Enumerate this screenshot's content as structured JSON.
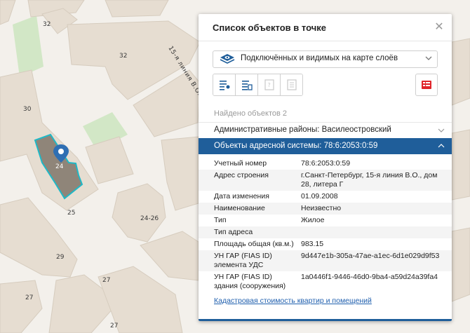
{
  "map": {
    "house_numbers": [
      "32",
      "32",
      "30",
      "24",
      "24-26",
      "29",
      "27",
      "27",
      "27",
      "25"
    ],
    "street_name": "15-я линия В.О.",
    "marker_icon": "map-pin-icon"
  },
  "panel": {
    "title": "Список объектов в точке",
    "close_icon": "close-icon",
    "layer_selector": {
      "value": "Подключённых и видимых на карте слоёв",
      "icon": "layers-eye-icon"
    },
    "toolbar_icons": [
      "list-pin-icon",
      "list-select-icon",
      "help-doc-icon",
      "document-icon"
    ],
    "right_tool_icon": "report-icon",
    "found_label": "Найдено объектов 2",
    "sections": [
      {
        "label": "Административные районы: Василеостровский",
        "expanded": false
      },
      {
        "label": "Объекты адресной системы: 78:6:2053:0:59",
        "expanded": true
      }
    ],
    "properties": [
      {
        "key": "Учетный номер",
        "value": "78:6:2053:0:59"
      },
      {
        "key": "Адрес строения",
        "value": "г.Санкт-Петербург, 15-я линия В.О., дом 28, литера Г"
      },
      {
        "key": "Дата изменения",
        "value": "01.09.2008"
      },
      {
        "key": "Наименование",
        "value": "Неизвестно"
      },
      {
        "key": "Тип",
        "value": "Жилое"
      },
      {
        "key": "Тип адреса",
        "value": ""
      },
      {
        "key": "Площадь общая (кв.м.)",
        "value": "983.15"
      },
      {
        "key": "УН ГАР (FIAS ID) элемента УДС",
        "value": "9d447e1b-305a-47ae-a1ec-6d1e029d9f53"
      },
      {
        "key": "УН ГАР (FIAS ID) здания (сооружения)",
        "value": "1a0446f1-9446-46d0-9ba4-a59d24a39fa4"
      }
    ],
    "link": "Кадастровая стоимость квартир и помещений"
  },
  "colors": {
    "accent": "#1f5e9a",
    "building": "#e5ddd2",
    "selected_outline": "#1fb8c6",
    "selected_fill": "#8f8579",
    "green": "#cfe6c4"
  }
}
